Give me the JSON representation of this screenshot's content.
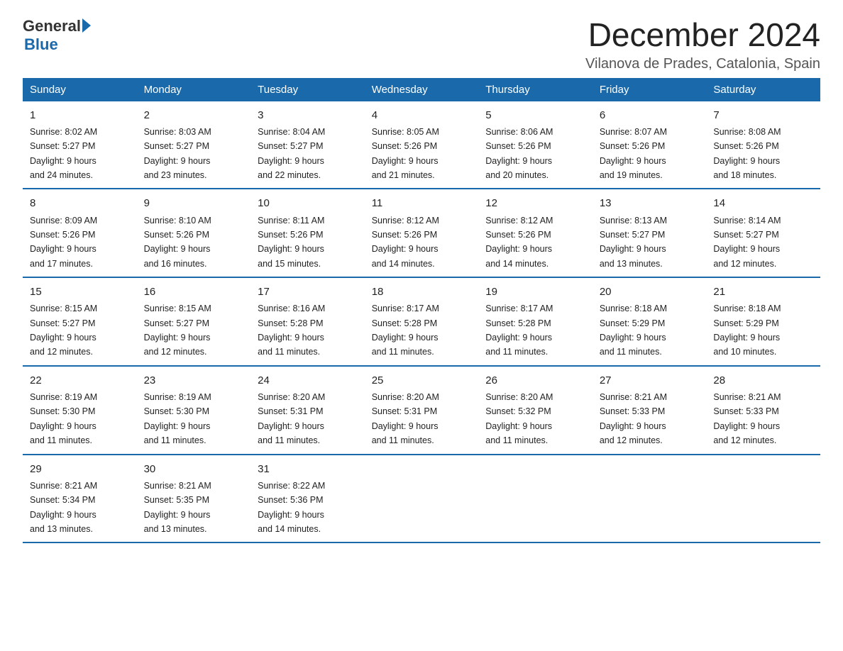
{
  "header": {
    "logo_general": "General",
    "logo_blue": "Blue",
    "title": "December 2024",
    "subtitle": "Vilanova de Prades, Catalonia, Spain"
  },
  "weekdays": [
    "Sunday",
    "Monday",
    "Tuesday",
    "Wednesday",
    "Thursday",
    "Friday",
    "Saturday"
  ],
  "weeks": [
    [
      {
        "day": "1",
        "sunrise": "8:02 AM",
        "sunset": "5:27 PM",
        "daylight": "9 hours and 24 minutes."
      },
      {
        "day": "2",
        "sunrise": "8:03 AM",
        "sunset": "5:27 PM",
        "daylight": "9 hours and 23 minutes."
      },
      {
        "day": "3",
        "sunrise": "8:04 AM",
        "sunset": "5:27 PM",
        "daylight": "9 hours and 22 minutes."
      },
      {
        "day": "4",
        "sunrise": "8:05 AM",
        "sunset": "5:26 PM",
        "daylight": "9 hours and 21 minutes."
      },
      {
        "day": "5",
        "sunrise": "8:06 AM",
        "sunset": "5:26 PM",
        "daylight": "9 hours and 20 minutes."
      },
      {
        "day": "6",
        "sunrise": "8:07 AM",
        "sunset": "5:26 PM",
        "daylight": "9 hours and 19 minutes."
      },
      {
        "day": "7",
        "sunrise": "8:08 AM",
        "sunset": "5:26 PM",
        "daylight": "9 hours and 18 minutes."
      }
    ],
    [
      {
        "day": "8",
        "sunrise": "8:09 AM",
        "sunset": "5:26 PM",
        "daylight": "9 hours and 17 minutes."
      },
      {
        "day": "9",
        "sunrise": "8:10 AM",
        "sunset": "5:26 PM",
        "daylight": "9 hours and 16 minutes."
      },
      {
        "day": "10",
        "sunrise": "8:11 AM",
        "sunset": "5:26 PM",
        "daylight": "9 hours and 15 minutes."
      },
      {
        "day": "11",
        "sunrise": "8:12 AM",
        "sunset": "5:26 PM",
        "daylight": "9 hours and 14 minutes."
      },
      {
        "day": "12",
        "sunrise": "8:12 AM",
        "sunset": "5:26 PM",
        "daylight": "9 hours and 14 minutes."
      },
      {
        "day": "13",
        "sunrise": "8:13 AM",
        "sunset": "5:27 PM",
        "daylight": "9 hours and 13 minutes."
      },
      {
        "day": "14",
        "sunrise": "8:14 AM",
        "sunset": "5:27 PM",
        "daylight": "9 hours and 12 minutes."
      }
    ],
    [
      {
        "day": "15",
        "sunrise": "8:15 AM",
        "sunset": "5:27 PM",
        "daylight": "9 hours and 12 minutes."
      },
      {
        "day": "16",
        "sunrise": "8:15 AM",
        "sunset": "5:27 PM",
        "daylight": "9 hours and 12 minutes."
      },
      {
        "day": "17",
        "sunrise": "8:16 AM",
        "sunset": "5:28 PM",
        "daylight": "9 hours and 11 minutes."
      },
      {
        "day": "18",
        "sunrise": "8:17 AM",
        "sunset": "5:28 PM",
        "daylight": "9 hours and 11 minutes."
      },
      {
        "day": "19",
        "sunrise": "8:17 AM",
        "sunset": "5:28 PM",
        "daylight": "9 hours and 11 minutes."
      },
      {
        "day": "20",
        "sunrise": "8:18 AM",
        "sunset": "5:29 PM",
        "daylight": "9 hours and 11 minutes."
      },
      {
        "day": "21",
        "sunrise": "8:18 AM",
        "sunset": "5:29 PM",
        "daylight": "9 hours and 10 minutes."
      }
    ],
    [
      {
        "day": "22",
        "sunrise": "8:19 AM",
        "sunset": "5:30 PM",
        "daylight": "9 hours and 11 minutes."
      },
      {
        "day": "23",
        "sunrise": "8:19 AM",
        "sunset": "5:30 PM",
        "daylight": "9 hours and 11 minutes."
      },
      {
        "day": "24",
        "sunrise": "8:20 AM",
        "sunset": "5:31 PM",
        "daylight": "9 hours and 11 minutes."
      },
      {
        "day": "25",
        "sunrise": "8:20 AM",
        "sunset": "5:31 PM",
        "daylight": "9 hours and 11 minutes."
      },
      {
        "day": "26",
        "sunrise": "8:20 AM",
        "sunset": "5:32 PM",
        "daylight": "9 hours and 11 minutes."
      },
      {
        "day": "27",
        "sunrise": "8:21 AM",
        "sunset": "5:33 PM",
        "daylight": "9 hours and 12 minutes."
      },
      {
        "day": "28",
        "sunrise": "8:21 AM",
        "sunset": "5:33 PM",
        "daylight": "9 hours and 12 minutes."
      }
    ],
    [
      {
        "day": "29",
        "sunrise": "8:21 AM",
        "sunset": "5:34 PM",
        "daylight": "9 hours and 13 minutes."
      },
      {
        "day": "30",
        "sunrise": "8:21 AM",
        "sunset": "5:35 PM",
        "daylight": "9 hours and 13 minutes."
      },
      {
        "day": "31",
        "sunrise": "8:22 AM",
        "sunset": "5:36 PM",
        "daylight": "9 hours and 14 minutes."
      },
      null,
      null,
      null,
      null
    ]
  ],
  "labels": {
    "sunrise": "Sunrise:",
    "sunset": "Sunset:",
    "daylight": "Daylight:"
  }
}
